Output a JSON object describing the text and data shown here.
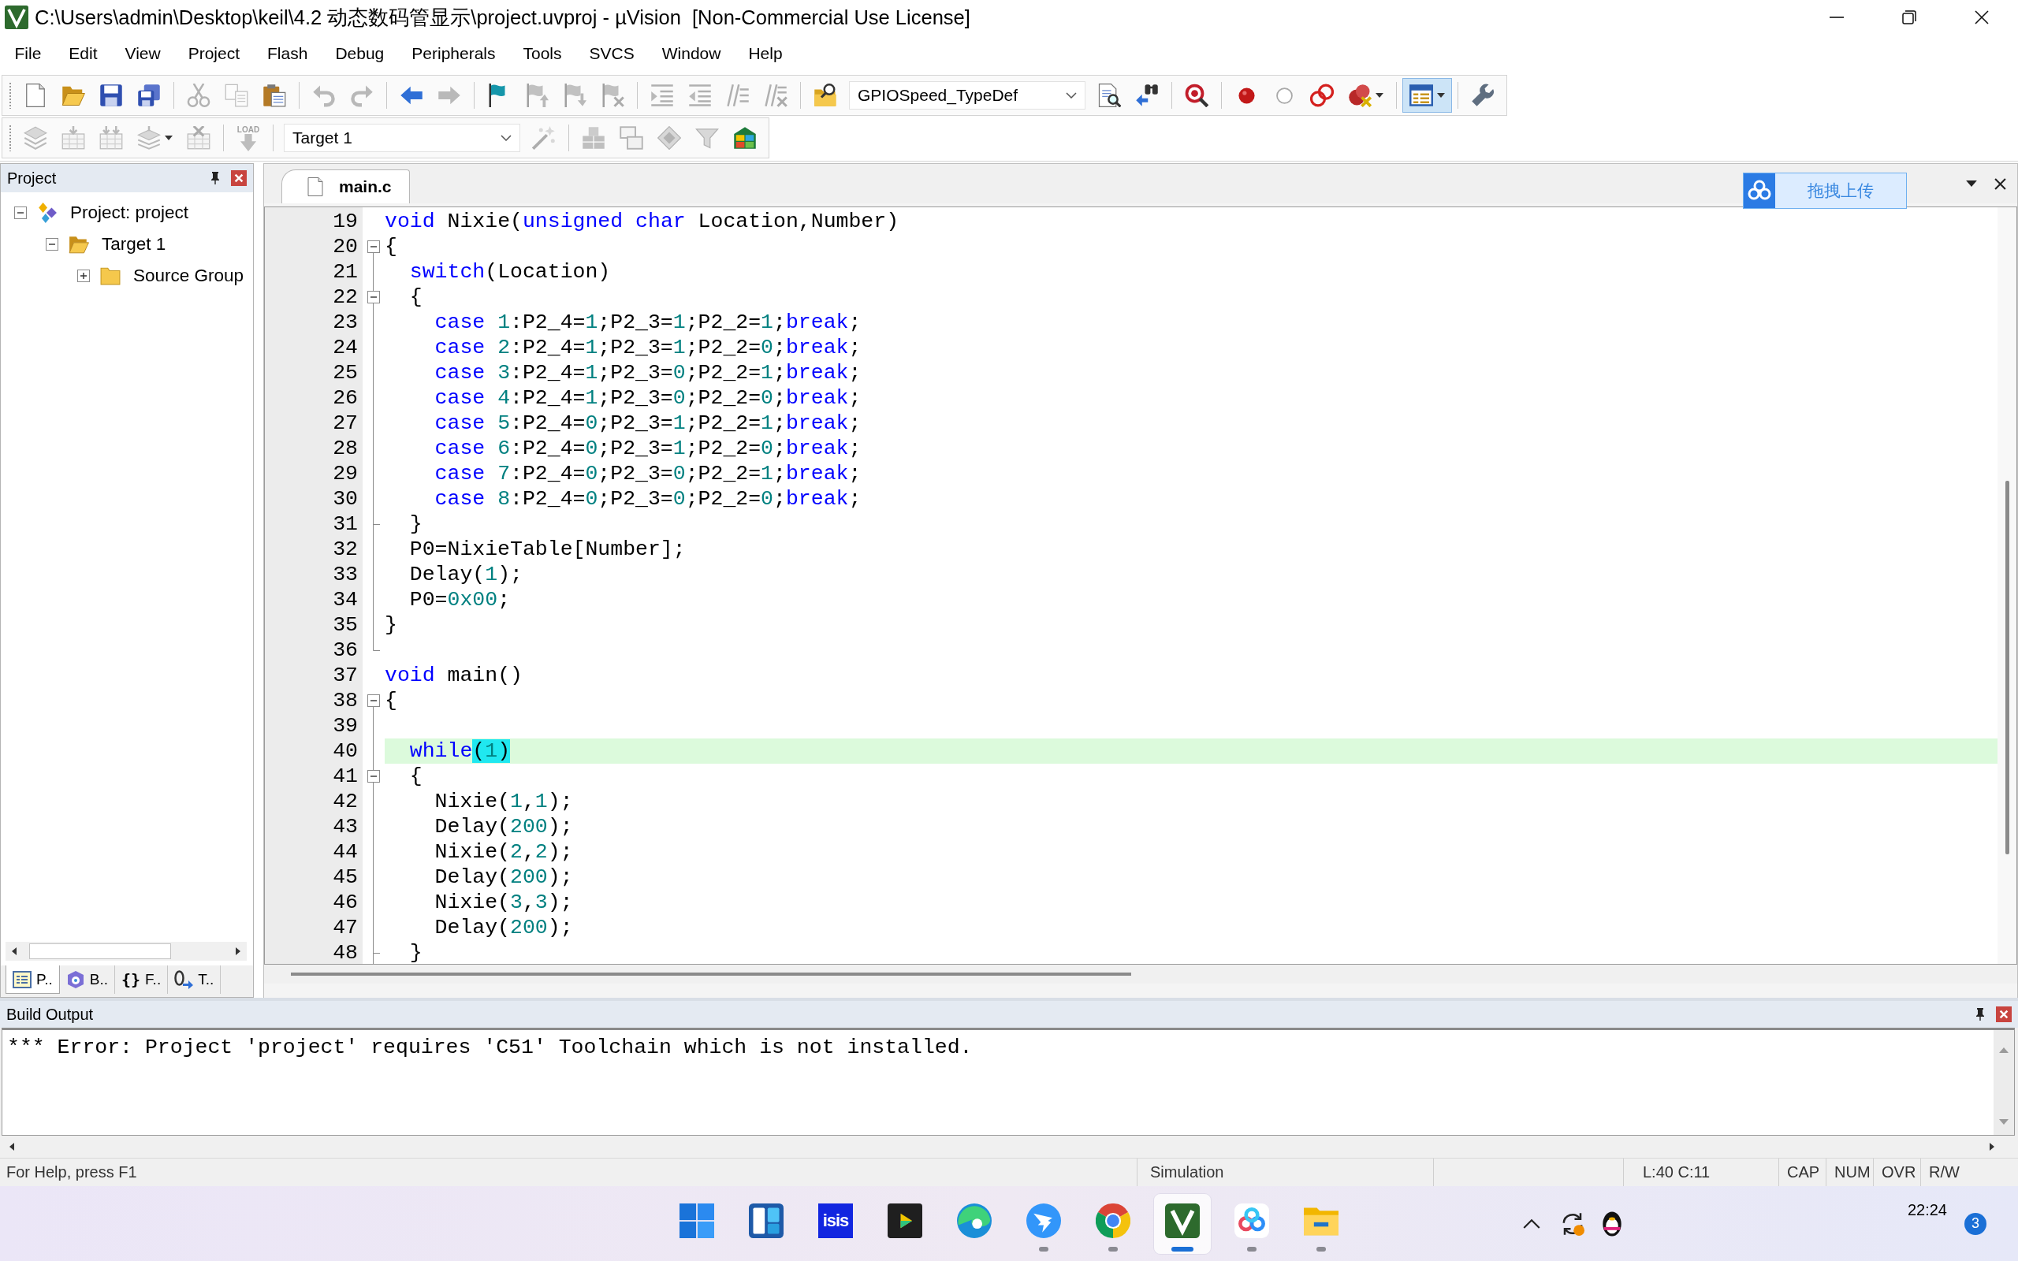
{
  "window": {
    "title": "C:\\Users\\admin\\Desktop\\keil\\4.2 动态数码管显示\\project.uvproj - µVision  [Non-Commercial Use License]"
  },
  "menu": [
    "File",
    "Edit",
    "View",
    "Project",
    "Flash",
    "Debug",
    "Peripherals",
    "Tools",
    "SVCS",
    "Window",
    "Help"
  ],
  "toolbar_1": [
    {
      "kind": "new",
      "disabled": false,
      "pressed": false,
      "split": false
    },
    {
      "kind": "open",
      "disabled": false,
      "pressed": false,
      "split": false
    },
    {
      "kind": "save",
      "disabled": false,
      "pressed": false,
      "split": false
    },
    {
      "kind": "save_all",
      "disabled": false,
      "pressed": false,
      "split": false
    },
    {
      "kind": "separator"
    },
    {
      "kind": "cut",
      "disabled": true,
      "pressed": false,
      "split": false
    },
    {
      "kind": "copy",
      "disabled": true,
      "pressed": false,
      "split": false
    },
    {
      "kind": "paste",
      "disabled": false,
      "pressed": false,
      "split": false
    },
    {
      "kind": "separator"
    },
    {
      "kind": "undo",
      "disabled": true,
      "pressed": false,
      "split": false
    },
    {
      "kind": "redo",
      "disabled": true,
      "pressed": false,
      "split": false
    },
    {
      "kind": "separator"
    },
    {
      "kind": "back",
      "disabled": false,
      "pressed": false,
      "split": false
    },
    {
      "kind": "forward",
      "disabled": true,
      "pressed": false,
      "split": false
    },
    {
      "kind": "separator"
    },
    {
      "kind": "bookmark",
      "disabled": false,
      "pressed": false,
      "split": false
    },
    {
      "kind": "bookmark_prev",
      "disabled": true,
      "pressed": false,
      "split": false
    },
    {
      "kind": "bookmark_next",
      "disabled": true,
      "pressed": false,
      "split": false
    },
    {
      "kind": "bookmark_clear",
      "disabled": true,
      "pressed": false,
      "split": false
    },
    {
      "kind": "separator"
    },
    {
      "kind": "indent",
      "disabled": true,
      "pressed": false,
      "split": false
    },
    {
      "kind": "outdent",
      "disabled": true,
      "pressed": false,
      "split": false
    },
    {
      "kind": "comment",
      "disabled": true,
      "pressed": false,
      "split": false
    },
    {
      "kind": "uncomment",
      "disabled": true,
      "pressed": false,
      "split": false
    },
    {
      "kind": "separator"
    },
    {
      "kind": "find_in_files",
      "disabled": false,
      "pressed": false,
      "split": false
    },
    {
      "kind": "combo",
      "value": "GPIOSpeed_TypeDef"
    },
    {
      "kind": "find",
      "disabled": false,
      "pressed": false,
      "split": false
    },
    {
      "kind": "incremental_find",
      "disabled": false,
      "pressed": false,
      "split": false
    },
    {
      "kind": "separator"
    },
    {
      "kind": "debug",
      "disabled": false,
      "pressed": false,
      "split": false
    },
    {
      "kind": "separator"
    },
    {
      "kind": "breakpoint",
      "disabled": false,
      "pressed": false,
      "split": false
    },
    {
      "kind": "breakpoint_disable",
      "disabled": false,
      "pressed": false,
      "split": false
    },
    {
      "kind": "breakpoint_kill",
      "disabled": false,
      "pressed": false,
      "split": false
    },
    {
      "kind": "breakpoint_disable_all",
      "disabled": false,
      "pressed": false,
      "split": true
    },
    {
      "kind": "separator"
    },
    {
      "kind": "layout",
      "disabled": false,
      "pressed": true,
      "split": true
    },
    {
      "kind": "separator"
    },
    {
      "kind": "configure",
      "disabled": false,
      "pressed": false,
      "split": false
    }
  ],
  "toolbar_2": [
    {
      "kind": "translate",
      "disabled": true,
      "pressed": false,
      "split": false
    },
    {
      "kind": "build",
      "disabled": true,
      "pressed": false,
      "split": false
    },
    {
      "kind": "rebuild",
      "disabled": true,
      "pressed": false,
      "split": false
    },
    {
      "kind": "batch",
      "disabled": true,
      "pressed": false,
      "split": true
    },
    {
      "kind": "stop",
      "disabled": true,
      "pressed": false,
      "split": false
    },
    {
      "kind": "separator"
    },
    {
      "kind": "load",
      "label": "LOAD",
      "disabled": true,
      "pressed": false,
      "split": false
    },
    {
      "kind": "separator"
    },
    {
      "kind": "combo",
      "value": "Target 1"
    },
    {
      "kind": "options",
      "disabled": true,
      "pressed": false,
      "split": false
    },
    {
      "kind": "separator"
    },
    {
      "kind": "rte_manage",
      "disabled": true,
      "pressed": false,
      "split": false
    },
    {
      "kind": "rte_select",
      "disabled": true,
      "pressed": false,
      "split": false
    },
    {
      "kind": "rte_diamond",
      "disabled": true,
      "pressed": false,
      "split": false
    },
    {
      "kind": "rte_funnel",
      "disabled": true,
      "pressed": false,
      "split": false
    },
    {
      "kind": "pack",
      "disabled": false,
      "pressed": false,
      "split": false
    }
  ],
  "project_panel": {
    "title": "Project",
    "tree": [
      {
        "label": "Project: project",
        "kind": "project",
        "expanded": true,
        "selected": false,
        "children": [
          {
            "label": "Target 1",
            "kind": "target",
            "expanded": true,
            "selected": false,
            "children": [
              {
                "label": "Source Group",
                "kind": "group",
                "expanded": false,
                "selected": false
              }
            ]
          }
        ]
      }
    ],
    "tabs": [
      {
        "kind": "project",
        "label": "P..",
        "selected": true
      },
      {
        "kind": "books",
        "label": "B..",
        "selected": false
      },
      {
        "kind": "functions",
        "glyph": "{}",
        "label": "F..",
        "selected": false
      },
      {
        "kind": "templates",
        "label": "T..",
        "selected": false
      }
    ]
  },
  "editor": {
    "tabs": [
      {
        "label": "main.c",
        "selected": true
      }
    ],
    "upload_button": {
      "label": "拖拽上传"
    },
    "lines": [
      {
        "number": "19",
        "kind": "plain",
        "current": false,
        "tokens": [
          {
            "kind": "keyword",
            "text": "void"
          },
          {
            "kind": "plain",
            "text": " Nixie("
          },
          {
            "kind": "keyword",
            "text": "unsigned "
          },
          {
            "kind": "keyword",
            "text": "char"
          },
          {
            "kind": "plain",
            "text": " Location,Number)"
          }
        ]
      },
      {
        "number": "20",
        "kind": "start",
        "current": false,
        "tokens": [
          {
            "kind": "plain",
            "text": "{"
          }
        ]
      },
      {
        "number": "21",
        "kind": "body",
        "current": false,
        "tokens": [
          {
            "kind": "keyword",
            "text": "  switch"
          },
          {
            "kind": "plain",
            "text": "(Location)"
          }
        ]
      },
      {
        "number": "22",
        "kind": "nest",
        "current": false,
        "tokens": [
          {
            "kind": "plain",
            "text": "  {"
          }
        ]
      },
      {
        "number": "23",
        "kind": "body",
        "current": false,
        "tokens": [
          {
            "kind": "keyword",
            "text": "    case "
          },
          {
            "kind": "number",
            "text": "1"
          },
          {
            "kind": "plain",
            "text": ":P2_4="
          },
          {
            "kind": "number",
            "text": "1"
          },
          {
            "kind": "plain",
            "text": ";P2_3="
          },
          {
            "kind": "number",
            "text": "1"
          },
          {
            "kind": "plain",
            "text": ";P2_2="
          },
          {
            "kind": "number",
            "text": "1"
          },
          {
            "kind": "plain",
            "text": ";"
          },
          {
            "kind": "keyword",
            "text": "break"
          },
          {
            "kind": "plain",
            "text": ";"
          }
        ]
      },
      {
        "number": "24",
        "kind": "body",
        "current": false,
        "tokens": [
          {
            "kind": "keyword",
            "text": "    case "
          },
          {
            "kind": "number",
            "text": "2"
          },
          {
            "kind": "plain",
            "text": ":P2_4="
          },
          {
            "kind": "number",
            "text": "1"
          },
          {
            "kind": "plain",
            "text": ";P2_3="
          },
          {
            "kind": "number",
            "text": "1"
          },
          {
            "kind": "plain",
            "text": ";P2_2="
          },
          {
            "kind": "number",
            "text": "0"
          },
          {
            "kind": "plain",
            "text": ";"
          },
          {
            "kind": "keyword",
            "text": "break"
          },
          {
            "kind": "plain",
            "text": ";"
          }
        ]
      },
      {
        "number": "25",
        "kind": "body",
        "current": false,
        "tokens": [
          {
            "kind": "keyword",
            "text": "    case "
          },
          {
            "kind": "number",
            "text": "3"
          },
          {
            "kind": "plain",
            "text": ":P2_4="
          },
          {
            "kind": "number",
            "text": "1"
          },
          {
            "kind": "plain",
            "text": ";P2_3="
          },
          {
            "kind": "number",
            "text": "0"
          },
          {
            "kind": "plain",
            "text": ";P2_2="
          },
          {
            "kind": "number",
            "text": "1"
          },
          {
            "kind": "plain",
            "text": ";"
          },
          {
            "kind": "keyword",
            "text": "break"
          },
          {
            "kind": "plain",
            "text": ";"
          }
        ]
      },
      {
        "number": "26",
        "kind": "body",
        "current": false,
        "tokens": [
          {
            "kind": "keyword",
            "text": "    case "
          },
          {
            "kind": "number",
            "text": "4"
          },
          {
            "kind": "plain",
            "text": ":P2_4="
          },
          {
            "kind": "number",
            "text": "1"
          },
          {
            "kind": "plain",
            "text": ";P2_3="
          },
          {
            "kind": "number",
            "text": "0"
          },
          {
            "kind": "plain",
            "text": ";P2_2="
          },
          {
            "kind": "number",
            "text": "0"
          },
          {
            "kind": "plain",
            "text": ";"
          },
          {
            "kind": "keyword",
            "text": "break"
          },
          {
            "kind": "plain",
            "text": ";"
          }
        ]
      },
      {
        "number": "27",
        "kind": "body",
        "current": false,
        "tokens": [
          {
            "kind": "keyword",
            "text": "    case "
          },
          {
            "kind": "number",
            "text": "5"
          },
          {
            "kind": "plain",
            "text": ":P2_4="
          },
          {
            "kind": "number",
            "text": "0"
          },
          {
            "kind": "plain",
            "text": ";P2_3="
          },
          {
            "kind": "number",
            "text": "1"
          },
          {
            "kind": "plain",
            "text": ";P2_2="
          },
          {
            "kind": "number",
            "text": "1"
          },
          {
            "kind": "plain",
            "text": ";"
          },
          {
            "kind": "keyword",
            "text": "break"
          },
          {
            "kind": "plain",
            "text": ";"
          }
        ]
      },
      {
        "number": "28",
        "kind": "body",
        "current": false,
        "tokens": [
          {
            "kind": "keyword",
            "text": "    case "
          },
          {
            "kind": "number",
            "text": "6"
          },
          {
            "kind": "plain",
            "text": ":P2_4="
          },
          {
            "kind": "number",
            "text": "0"
          },
          {
            "kind": "plain",
            "text": ";P2_3="
          },
          {
            "kind": "number",
            "text": "1"
          },
          {
            "kind": "plain",
            "text": ";P2_2="
          },
          {
            "kind": "number",
            "text": "0"
          },
          {
            "kind": "plain",
            "text": ";"
          },
          {
            "kind": "keyword",
            "text": "break"
          },
          {
            "kind": "plain",
            "text": ";"
          }
        ]
      },
      {
        "number": "29",
        "kind": "body",
        "current": false,
        "tokens": [
          {
            "kind": "keyword",
            "text": "    case "
          },
          {
            "kind": "number",
            "text": "7"
          },
          {
            "kind": "plain",
            "text": ":P2_4="
          },
          {
            "kind": "number",
            "text": "0"
          },
          {
            "kind": "plain",
            "text": ";P2_3="
          },
          {
            "kind": "number",
            "text": "0"
          },
          {
            "kind": "plain",
            "text": ";P2_2="
          },
          {
            "kind": "number",
            "text": "1"
          },
          {
            "kind": "plain",
            "text": ";"
          },
          {
            "kind": "keyword",
            "text": "break"
          },
          {
            "kind": "plain",
            "text": ";"
          }
        ]
      },
      {
        "number": "30",
        "kind": "body",
        "current": false,
        "tokens": [
          {
            "kind": "keyword",
            "text": "    case "
          },
          {
            "kind": "number",
            "text": "8"
          },
          {
            "kind": "plain",
            "text": ":P2_4="
          },
          {
            "kind": "number",
            "text": "0"
          },
          {
            "kind": "plain",
            "text": ";P2_3="
          },
          {
            "kind": "number",
            "text": "0"
          },
          {
            "kind": "plain",
            "text": ";P2_2="
          },
          {
            "kind": "number",
            "text": "0"
          },
          {
            "kind": "plain",
            "text": ";"
          },
          {
            "kind": "keyword",
            "text": "break"
          },
          {
            "kind": "plain",
            "text": ";"
          }
        ]
      },
      {
        "number": "31",
        "kind": "branch",
        "current": false,
        "tokens": [
          {
            "kind": "plain",
            "text": "  }"
          }
        ]
      },
      {
        "number": "32",
        "kind": "body",
        "current": false,
        "tokens": [
          {
            "kind": "plain",
            "text": "  P0=NixieTable[Number];"
          }
        ]
      },
      {
        "number": "33",
        "kind": "body",
        "current": false,
        "tokens": [
          {
            "kind": "plain",
            "text": "  Delay("
          },
          {
            "kind": "number",
            "text": "1"
          },
          {
            "kind": "plain",
            "text": ");"
          }
        ]
      },
      {
        "number": "34",
        "kind": "body",
        "current": false,
        "tokens": [
          {
            "kind": "plain",
            "text": "  P0="
          },
          {
            "kind": "number",
            "text": "0x00"
          },
          {
            "kind": "plain",
            "text": ";"
          }
        ]
      },
      {
        "number": "35",
        "kind": "body",
        "current": false,
        "tokens": [
          {
            "kind": "plain",
            "text": "}"
          }
        ]
      },
      {
        "number": "36",
        "kind": "end",
        "current": false
      },
      {
        "number": "37",
        "kind": "plain",
        "current": false,
        "tokens": [
          {
            "kind": "keyword",
            "text": "void"
          },
          {
            "kind": "plain",
            "text": " main()"
          }
        ]
      },
      {
        "number": "38",
        "kind": "start",
        "current": false,
        "tokens": [
          {
            "kind": "plain",
            "text": "{"
          }
        ]
      },
      {
        "number": "39",
        "kind": "body",
        "current": false
      },
      {
        "number": "40",
        "kind": "body",
        "current": true,
        "tokens": [
          {
            "kind": "keyword",
            "text": "  while"
          },
          {
            "kind": "match",
            "text": "("
          },
          {
            "kind": "match_number",
            "text": "1"
          },
          {
            "kind": "match",
            "text": ")"
          }
        ]
      },
      {
        "number": "41",
        "kind": "nest",
        "current": false,
        "tokens": [
          {
            "kind": "plain",
            "text": "  {"
          }
        ]
      },
      {
        "number": "42",
        "kind": "body",
        "current": false,
        "tokens": [
          {
            "kind": "plain",
            "text": "    Nixie("
          },
          {
            "kind": "number",
            "text": "1"
          },
          {
            "kind": "plain",
            "text": ","
          },
          {
            "kind": "number",
            "text": "1"
          },
          {
            "kind": "plain",
            "text": ");"
          }
        ]
      },
      {
        "number": "43",
        "kind": "body",
        "current": false,
        "tokens": [
          {
            "kind": "plain",
            "text": "    Delay("
          },
          {
            "kind": "number",
            "text": "200"
          },
          {
            "kind": "plain",
            "text": ");"
          }
        ]
      },
      {
        "number": "44",
        "kind": "body",
        "current": false,
        "tokens": [
          {
            "kind": "plain",
            "text": "    Nixie("
          },
          {
            "kind": "number",
            "text": "2"
          },
          {
            "kind": "plain",
            "text": ","
          },
          {
            "kind": "number",
            "text": "2"
          },
          {
            "kind": "plain",
            "text": ");"
          }
        ]
      },
      {
        "number": "45",
        "kind": "body",
        "current": false,
        "tokens": [
          {
            "kind": "plain",
            "text": "    Delay("
          },
          {
            "kind": "number",
            "text": "200"
          },
          {
            "kind": "plain",
            "text": ");"
          }
        ]
      },
      {
        "number": "46",
        "kind": "body",
        "current": false,
        "tokens": [
          {
            "kind": "plain",
            "text": "    Nixie("
          },
          {
            "kind": "number",
            "text": "3"
          },
          {
            "kind": "plain",
            "text": ","
          },
          {
            "kind": "number",
            "text": "3"
          },
          {
            "kind": "plain",
            "text": ");"
          }
        ]
      },
      {
        "number": "47",
        "kind": "body",
        "current": false,
        "tokens": [
          {
            "kind": "plain",
            "text": "    Delay("
          },
          {
            "kind": "number",
            "text": "200"
          },
          {
            "kind": "plain",
            "text": ");"
          }
        ]
      },
      {
        "number": "48",
        "kind": "branch",
        "current": false,
        "tokens": [
          {
            "kind": "plain",
            "text": "  }"
          }
        ]
      }
    ]
  },
  "build_output": {
    "title": "Build Output",
    "lines": [
      "*** Error: Project 'project' requires 'C51' Toolchain which is not installed."
    ]
  },
  "status_bar": {
    "help": "For Help, press F1",
    "mode": "Simulation",
    "position": "L:40 C:11",
    "indicators": [
      "CAP",
      "NUM",
      "OVR",
      "R/W"
    ]
  },
  "taskbar": {
    "apps": [
      {
        "kind": "start",
        "running": false,
        "active": false
      },
      {
        "kind": "widgets",
        "running": false,
        "active": false
      },
      {
        "kind": "isis",
        "label": "isis",
        "running": false,
        "active": false
      },
      {
        "kind": "player",
        "running": false,
        "active": false
      },
      {
        "kind": "edge",
        "running": false,
        "active": false
      },
      {
        "kind": "messenger",
        "running": true,
        "active": false
      },
      {
        "kind": "chrome",
        "running": true,
        "active": false
      },
      {
        "kind": "uvision",
        "running": true,
        "active": true
      },
      {
        "kind": "cloud",
        "running": true,
        "active": false
      },
      {
        "kind": "explorer",
        "running": true,
        "active": false
      }
    ],
    "clock": "22:24",
    "notifications": "3"
  }
}
